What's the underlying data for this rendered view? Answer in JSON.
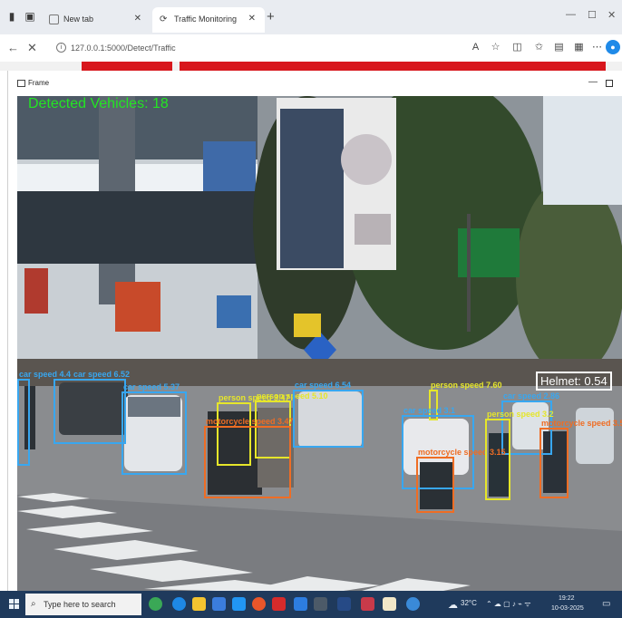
{
  "browser": {
    "tabs": [
      {
        "title": "New tab"
      },
      {
        "title": "Traffic Monitoring"
      }
    ],
    "new_tab_label": "+",
    "url": "127.0.0.1:5000/Detect/Traffic"
  },
  "window": {
    "title": "Frame"
  },
  "video": {
    "vehicle_count_label": "Detected Vehicles: 18",
    "detections": [
      {
        "label": "car speed 4.4",
        "color": "blue"
      },
      {
        "label": "car speed 6.52",
        "color": "blue"
      },
      {
        "label": "car speed 5.37",
        "color": "blue"
      },
      {
        "label": "person speed 3.47",
        "color": "yellow"
      },
      {
        "label": "person speed 5.10",
        "color": "yellow"
      },
      {
        "label": "motorcycle speed 3.47",
        "color": "orange"
      },
      {
        "label": "car speed 6.54",
        "color": "blue"
      },
      {
        "label": "person speed 7.60",
        "color": "yellow"
      },
      {
        "label": "car speed 3.1",
        "color": "blue"
      },
      {
        "label": "car speed 2.86",
        "color": "blue"
      },
      {
        "label": "motorcycle speed 3.15",
        "color": "orange"
      },
      {
        "label": "person speed 3.2",
        "color": "yellow"
      },
      {
        "label": "motorcycle speed 3.50",
        "color": "orange"
      }
    ],
    "helmet_label": "Helmet: 0.54"
  },
  "taskbar": {
    "search_placeholder": "Type here to search",
    "temperature": "32°C",
    "time": "19:22",
    "date": "10-03-2025"
  },
  "colors": {
    "detection_car": "#38a7f0",
    "detection_person": "#e6e62a",
    "detection_motorcycle": "#ef6d24",
    "vehicle_count": "#23e523",
    "taskbar": "#1f3a5c",
    "page_accent": "#d8161c"
  }
}
